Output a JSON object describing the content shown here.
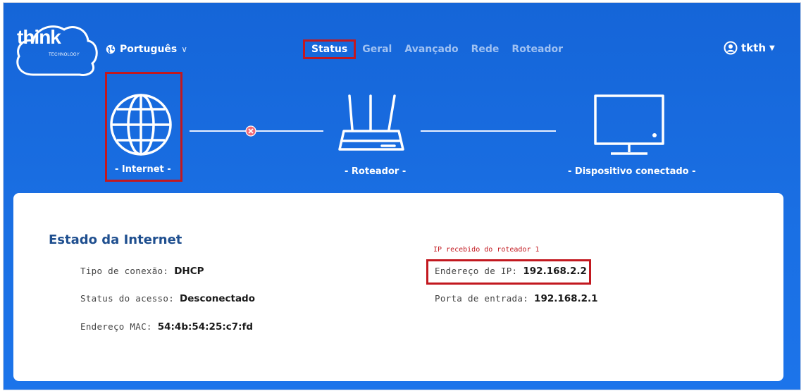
{
  "header": {
    "logo": {
      "text": "think",
      "sub": "TECHNOLOGY"
    },
    "language": {
      "label": "Português",
      "icon": "globe-icon",
      "chevron": "chevron-down-icon"
    },
    "nav": [
      {
        "label": "Status",
        "active": true
      },
      {
        "label": "Geral",
        "active": false
      },
      {
        "label": "Avançado",
        "active": false
      },
      {
        "label": "Rede",
        "active": false
      },
      {
        "label": "Roteador",
        "active": false
      }
    ],
    "user": {
      "name": "tkth",
      "icon": "user-icon"
    }
  },
  "topology": {
    "internet": {
      "label": "- Internet -",
      "icon": "globe-icon"
    },
    "router": {
      "label": "- Roteador -",
      "icon": "router-icon"
    },
    "device": {
      "label": "- Dispositivo conectado -",
      "icon": "monitor-icon"
    },
    "link_status_icon": "disconnected-x-icon"
  },
  "panel": {
    "title": "Estado da Internet",
    "left": [
      {
        "key": "Tipo de conexão:",
        "value": "DHCP"
      },
      {
        "key": "Status do acesso:",
        "value": "Desconectado"
      },
      {
        "key": "Endereço MAC:",
        "value": "54:4b:54:25:c7:fd"
      }
    ],
    "note": "IP recebido do roteador 1",
    "right": [
      {
        "key": "Endereço de IP:",
        "value": "192.168.2.2"
      },
      {
        "key": "Porta de entrada:",
        "value": "192.168.2.1"
      }
    ]
  },
  "colors": {
    "background": "#1a6fe3",
    "highlight": "#c2181f",
    "title": "#1f4f8f"
  }
}
